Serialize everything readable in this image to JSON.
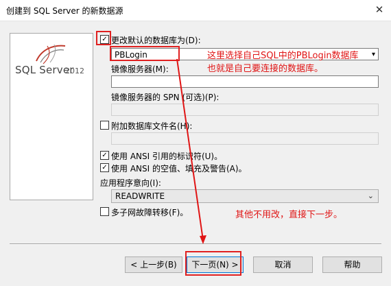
{
  "window": {
    "title": "创建到 SQL Server 的新数据源",
    "close_glyph": "✕"
  },
  "logo": {
    "product": "SQL Server",
    "version": "2012"
  },
  "form": {
    "change_default_db": {
      "label": "更改默认的数据库为(D):",
      "checked": true,
      "value": "PBLogin"
    },
    "mirror_server": {
      "label": "镜像服务器(M):",
      "value": ""
    },
    "mirror_spn": {
      "label": "镜像服务器的 SPN (可选)(P):",
      "value": ""
    },
    "attach_db_file": {
      "label": "附加数据库文件名(H):",
      "checked": false,
      "value": ""
    },
    "ansi_quoted": {
      "label": "使用 ANSI 引用的标识符(U)。",
      "checked": true
    },
    "ansi_nulls": {
      "label": "使用 ANSI 的空值、填充及警告(A)。",
      "checked": true
    },
    "app_intent": {
      "label": "应用程序意向(I):",
      "value": "READWRITE",
      "options": [
        "READWRITE"
      ]
    },
    "multi_subnet": {
      "label": "多子网故障转移(F)。",
      "checked": false
    }
  },
  "buttons": {
    "back": "< 上一步(B)",
    "next": "下一页(N) >",
    "cancel": "取消",
    "help": "帮助"
  },
  "annotations": {
    "line1": "这里选择自己SQL中的PBLogin数据库",
    "line2": "也就是自己要连接的数据库。",
    "line3": "其他不用改，直接下一步。",
    "color": "#e01414"
  }
}
